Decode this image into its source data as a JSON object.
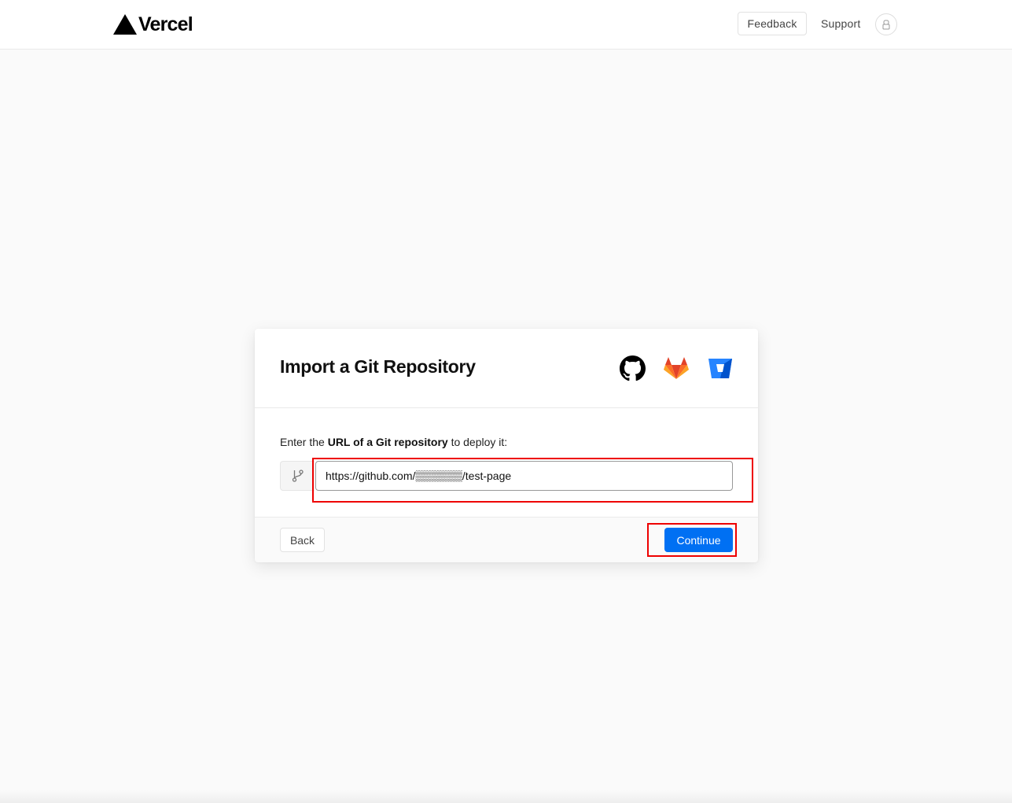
{
  "header": {
    "brand": "Vercel",
    "feedback_label": "Feedback",
    "support_label": "Support"
  },
  "card": {
    "title": "Import a Git Repository",
    "providers": [
      "github-icon",
      "gitlab-icon",
      "bitbucket-icon"
    ],
    "instruction_prefix": "Enter the ",
    "instruction_bold": "URL of a Git repository",
    "instruction_suffix": " to deploy it:",
    "repo_url_value": "https://github.com/▒▒▒▒▒▒/test-page",
    "back_label": "Back",
    "continue_label": "Continue"
  },
  "colors": {
    "accent": "#0070f3",
    "highlight": "#ee0000",
    "background": "#fafafa"
  }
}
